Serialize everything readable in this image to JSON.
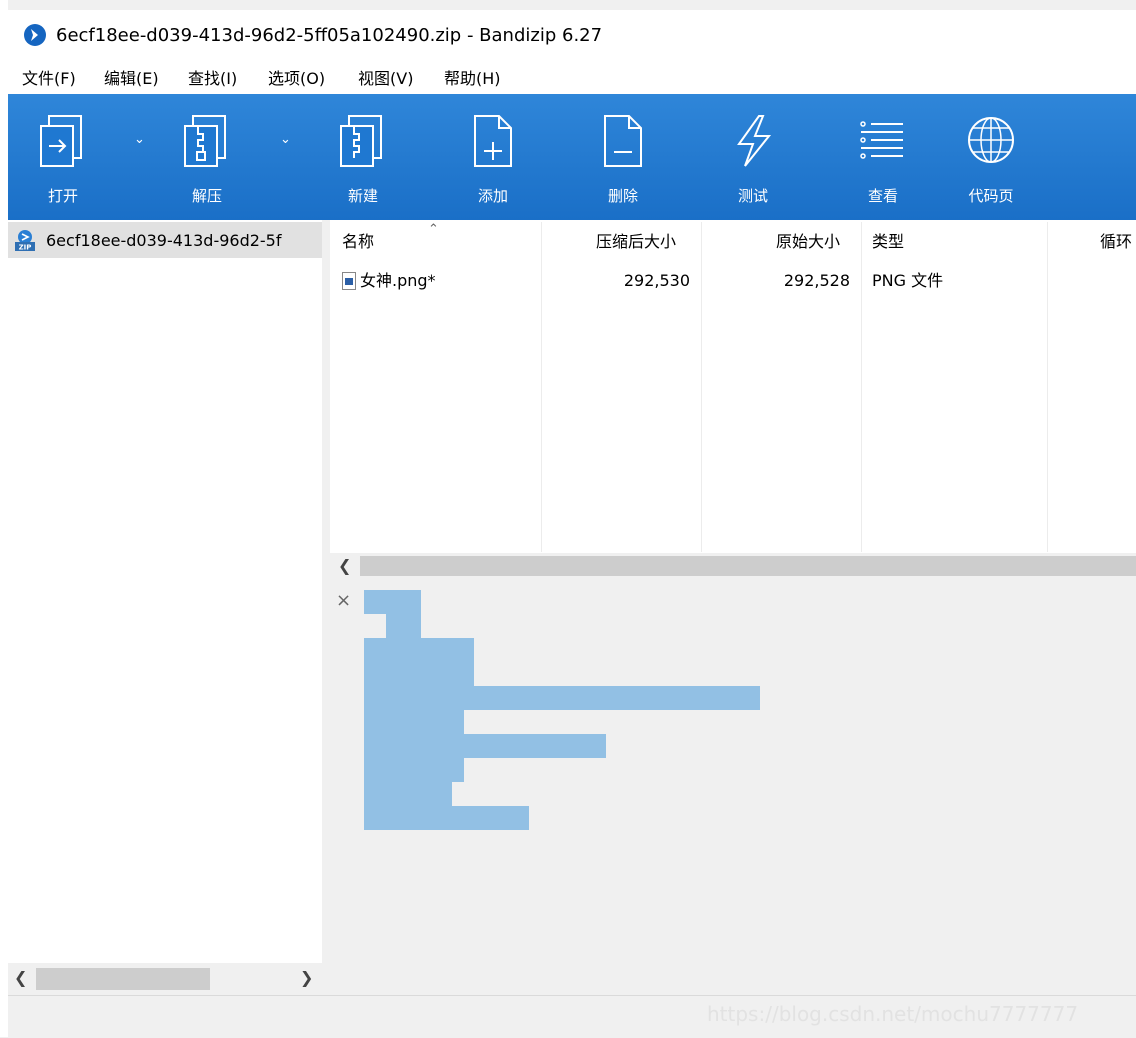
{
  "window": {
    "title": "6ecf18ee-d039-413d-96d2-5ff05a102490.zip - Bandizip 6.27"
  },
  "menu": [
    "文件(F)",
    "编辑(E)",
    "查找(I)",
    "选项(O)",
    "视图(V)",
    "帮助(H)"
  ],
  "toolbar": {
    "open": "打开",
    "extract": "解压",
    "new": "新建",
    "add": "添加",
    "delete": "删除",
    "test": "测试",
    "view": "查看",
    "codepage": "代码页"
  },
  "tree": {
    "root_label": "6ecf18ee-d039-413d-96d2-5f"
  },
  "list": {
    "columns": [
      "名称",
      "压缩后大小",
      "原始大小",
      "类型",
      "循环"
    ],
    "rows": [
      {
        "name": "女神.png*",
        "packed": "292,530",
        "size": "292,528",
        "type": "PNG 文件"
      }
    ]
  },
  "preview": {
    "close": "×"
  },
  "status": {
    "watermark": "https://blog.csdn.net/mochu7777777"
  },
  "colors": {
    "toolbar": "#1f78d1",
    "preview_fill": "#92c0e4"
  }
}
